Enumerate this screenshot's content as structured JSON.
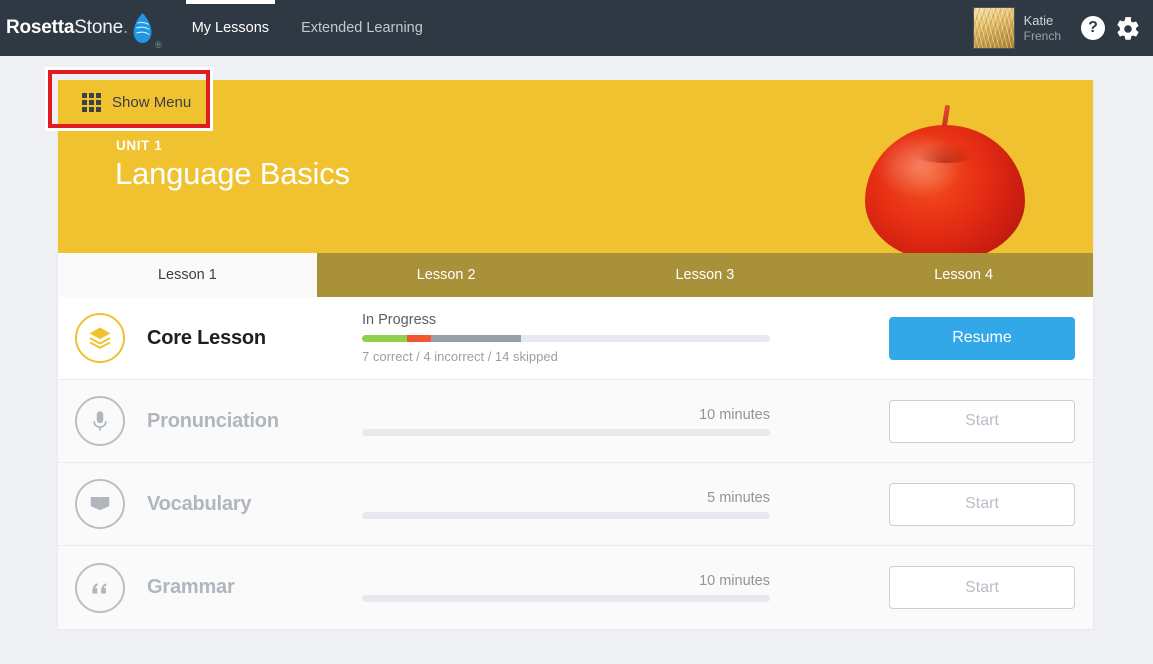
{
  "header": {
    "logo": {
      "bold": "Rosetta",
      "light": "Stone",
      "dot": ".",
      "tm": "®",
      "mark_icon": "rosetta-stone-logo-mark"
    },
    "nav": [
      {
        "label": "My Lessons",
        "active": true
      },
      {
        "label": "Extended Learning",
        "active": false
      }
    ],
    "user": {
      "name": "Katie",
      "language": "French",
      "avatar_icon": "wheat-field-avatar"
    },
    "help_icon": "question-mark-icon",
    "settings_icon": "gear-icon"
  },
  "show_menu": {
    "label": "Show Menu",
    "icon": "grid-menu-icon",
    "highlight_color": "#e01b22"
  },
  "banner": {
    "unit_label": "UNIT 1",
    "unit_title": "Language Basics",
    "background_color": "#f0c22f",
    "image_icon": "red-apple-image"
  },
  "lesson_tabs": [
    {
      "label": "Lesson 1",
      "active": true
    },
    {
      "label": "Lesson 2",
      "active": false
    },
    {
      "label": "Lesson 3",
      "active": false
    },
    {
      "label": "Lesson 4",
      "active": false
    }
  ],
  "activities": [
    {
      "title": "Core Lesson",
      "icon": "layers-stack-icon",
      "status": "In Progress",
      "substatus": "7 correct / 4 incorrect / 14 skipped",
      "progress": {
        "correct_pct": 11,
        "incorrect_pct": 6,
        "skipped_pct": 22
      },
      "button": "Resume"
    },
    {
      "title": "Pronunciation",
      "icon": "microphone-icon",
      "duration": "10 minutes",
      "progress": {
        "correct_pct": 0,
        "incorrect_pct": 0,
        "skipped_pct": 0
      },
      "button": "Start"
    },
    {
      "title": "Vocabulary",
      "icon": "open-book-icon",
      "duration": "5 minutes",
      "progress": {
        "correct_pct": 0,
        "incorrect_pct": 0,
        "skipped_pct": 0
      },
      "button": "Start"
    },
    {
      "title": "Grammar",
      "icon": "quotation-marks-icon",
      "duration": "10 minutes",
      "progress": {
        "correct_pct": 0,
        "incorrect_pct": 0,
        "skipped_pct": 0
      },
      "button": "Start"
    }
  ]
}
